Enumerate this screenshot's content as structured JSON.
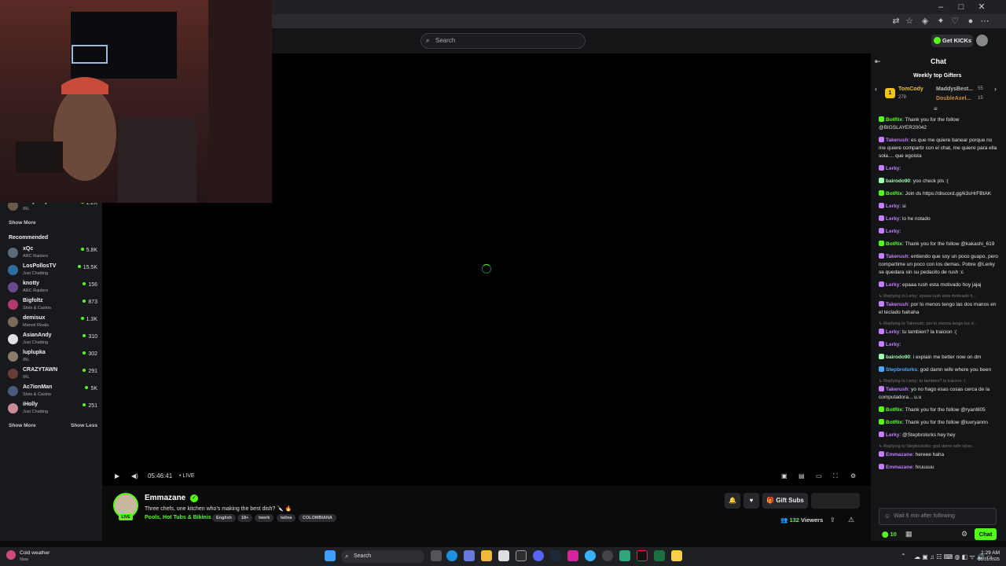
{
  "browser": {
    "window_controls": [
      "–",
      "□",
      "✕"
    ]
  },
  "header": {
    "search_placeholder": "Search",
    "get_kicks_label": "Get KICKs"
  },
  "sidebar": {
    "partial_top_item": {
      "name": "bailyxo3yalo",
      "category": "IRL",
      "viewers": "1.2K"
    },
    "show_more_top": "Show More",
    "recommended_title": "Recommended",
    "recommended": [
      {
        "name": "xQc",
        "category": "ARC Raiders",
        "viewers": "5.8K",
        "color": "#5b6b7a"
      },
      {
        "name": "LosPollosTV",
        "category": "Just Chatting",
        "viewers": "15.5K",
        "color": "#2f6ea0"
      },
      {
        "name": "knotty",
        "category": "ARC Raiders",
        "viewers": "156",
        "color": "#6a4a8c"
      },
      {
        "name": "Bigfoltz",
        "category": "Slots & Casino",
        "viewers": "873",
        "color": "#b03a6a"
      },
      {
        "name": "demisux",
        "category": "Marvel Rivals",
        "viewers": "1.3K",
        "color": "#7a6a5a"
      },
      {
        "name": "AsianAndy",
        "category": "Just Chatting",
        "viewers": "310",
        "color": "#e0e0e0"
      },
      {
        "name": "luplupka",
        "category": "IRL",
        "viewers": "302",
        "color": "#8a7a6a"
      },
      {
        "name": "CRAZYTAWN",
        "category": "IRL",
        "viewers": "291",
        "color": "#6a3a3a"
      },
      {
        "name": "Ac7ionMan",
        "category": "Slots & Casino",
        "viewers": "5K",
        "color": "#4a5a7a"
      },
      {
        "name": "iHolly",
        "category": "Just Chatting",
        "viewers": "251",
        "color": "#c98a9a"
      }
    ],
    "show_more": "Show More",
    "show_less": "Show Less"
  },
  "player": {
    "elapsed": "05:46:41",
    "live_label": "LIVE"
  },
  "stream": {
    "channel": "Emmazane",
    "live_badge": "LIVE",
    "title": "Three chefs, one kitchen  who's making the best dish? 🔪 🔥",
    "category": "Pools, Hot Tubs & Bikinis",
    "tags": [
      "English",
      "18+",
      "twerk",
      "latina",
      "COLOMBIANA"
    ],
    "gift_subs_label": "Gift Subs",
    "viewers_count": "132",
    "viewers_label": "Viewers"
  },
  "chat": {
    "title": "Chat",
    "gifters_title": "Weekly top Gifters",
    "gifters": [
      {
        "rank": "1",
        "name": "TomCody",
        "count": "278"
      },
      {
        "name": "MaddysBest...",
        "count": "55"
      },
      {
        "name": "DoubleAxel...",
        "count": "15"
      }
    ],
    "messages": [
      {
        "user": "BotRix",
        "color": "#53fc18",
        "text": "Thank you for the follow @BIGSLAYER20042"
      },
      {
        "user": "Takerush",
        "color": "#c77dff",
        "text": "es que me quiere banear porque no me quiere compartir con el chat, me quiere para ella sola.... que egoista"
      },
      {
        "user": "Lerky",
        "color": "#c77dff",
        "text": ""
      },
      {
        "user": "bairodo90",
        "color": "#9dffb0",
        "text": "yoo check pls :("
      },
      {
        "user": "BotRix",
        "color": "#53fc18",
        "text": "Join ds https://discord.gg/k3sHrFBtAK"
      },
      {
        "user": "Lerky",
        "color": "#c77dff",
        "text": "si"
      },
      {
        "user": "Lerky",
        "color": "#c77dff",
        "text": "lo he notado"
      },
      {
        "user": "Lerky",
        "color": "#c77dff",
        "text": ""
      },
      {
        "user": "BotRix",
        "color": "#53fc18",
        "text": "Thank you for the follow @kakashi_619"
      },
      {
        "user": "Takerush",
        "color": "#c77dff",
        "text": "entiendo que soy un poco guapo, pero compartime un poco con los demas. Pobre @Lerky se quedara sin su pedacito de rush :c"
      },
      {
        "user": "Lerky",
        "color": "#c77dff",
        "text": "epaaa rush esta motivado hoy jajaj"
      },
      {
        "reply": "Replying to Lerky: epaaa rush esta motivado h..."
      },
      {
        "user": "Takerush",
        "color": "#c77dff",
        "text": "por lo menos tengo las dos manos en el teclado hahaha"
      },
      {
        "reply": "Replying to Takerush: por lo menos tengo las d..."
      },
      {
        "user": "Lerky",
        "color": "#c77dff",
        "text": "tu tambien? la traicion :("
      },
      {
        "user": "Lerky",
        "color": "#c77dff",
        "text": ""
      },
      {
        "user": "bairodo90",
        "color": "#9dffb0",
        "text": "i explain me better now on dm"
      },
      {
        "user": "Stepbrolurks",
        "color": "#4aa8ff",
        "text": "god damn wife where you been"
      },
      {
        "reply": "Replying to Lerky: tu tambien? la traicion :("
      },
      {
        "user": "Takerush",
        "color": "#c77dff",
        "text": "yo no hago esas cosas cerca de la computadora... u.u"
      },
      {
        "user": "BotRix",
        "color": "#53fc18",
        "text": "Thank you for the follow @ryanl805"
      },
      {
        "user": "BotRix",
        "color": "#53fc18",
        "text": "Thank you for the follow @iuvryannn"
      },
      {
        "user": "Lerky",
        "color": "#c77dff",
        "text": "@Stepbrolurks hey hey"
      },
      {
        "reply": "Replying to Stepbrolurks: god damn wife wher..."
      },
      {
        "user": "Emmazane",
        "color": "#c77dff",
        "text": "hereee haha"
      },
      {
        "user": "Emmazane",
        "color": "#c77dff",
        "text": "hruuuuu"
      }
    ],
    "input_placeholder": "Wait 6 min after following",
    "points": "10",
    "send_label": "Chat"
  },
  "taskbar": {
    "weather_title": "Cold weather",
    "weather_sub": "Now",
    "search_label": "Search",
    "time": "1:29 AM",
    "date": "10/31/2025"
  }
}
